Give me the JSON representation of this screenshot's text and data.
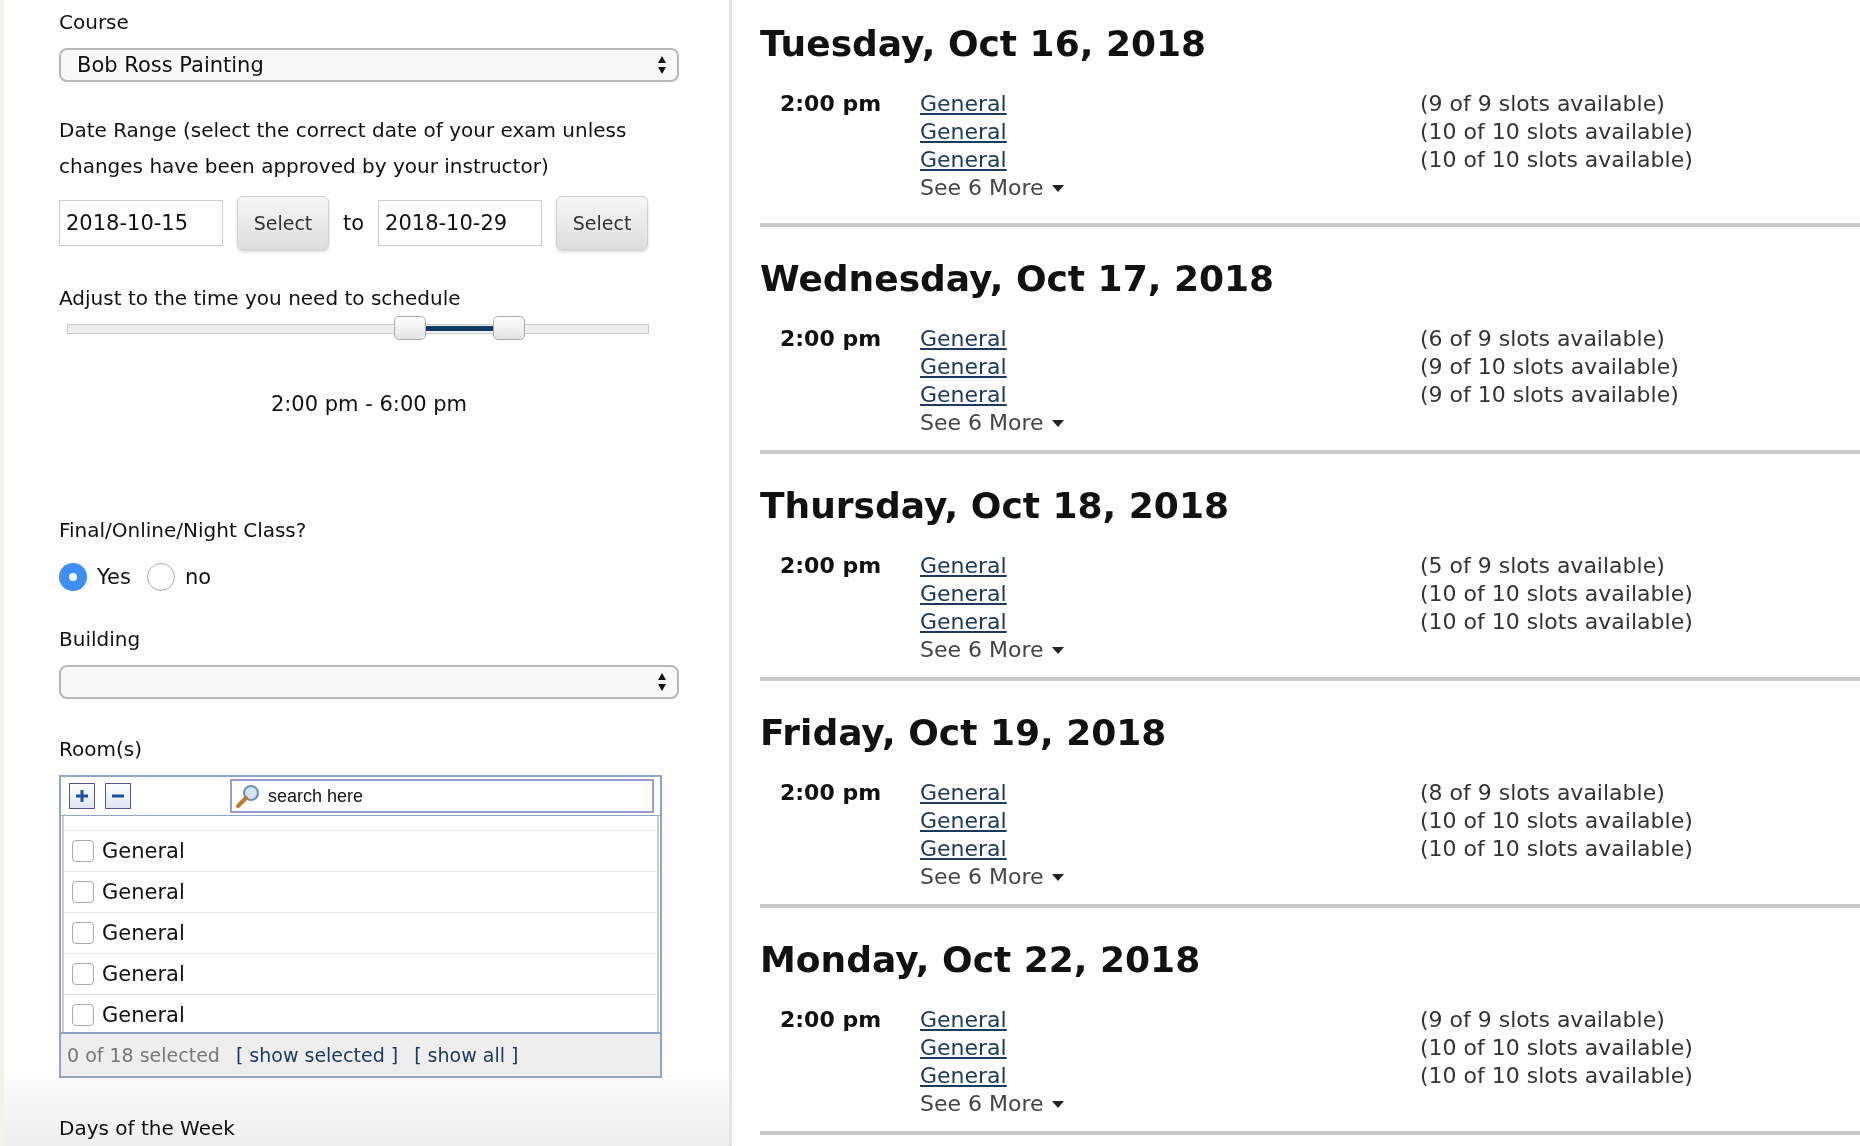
{
  "filters": {
    "course": {
      "label": "Course",
      "value": "Bob Ross Painting"
    },
    "date_range": {
      "label": "Date Range (select the correct date of your exam unless changes have been approved by your instructor)",
      "from": "2018-10-15",
      "from_button": "Select",
      "separator": "to",
      "to": "2018-10-29",
      "to_button": "Select"
    },
    "time_slider": {
      "label": "Adjust to the time you need to schedule",
      "thumbs": [
        {
          "level": 0.59
        },
        {
          "level": 0.76
        }
      ],
      "reading": "2:00 pm - 6:00 pm"
    },
    "final_class": {
      "label": "Final/Online/Night Class?",
      "options": [
        {
          "label": "Yes",
          "selected": true
        },
        {
          "label": "no",
          "selected": false
        }
      ]
    },
    "building": {
      "label": "Building"
    },
    "rooms": {
      "label": "Room(s)",
      "search_placeholder": "search here",
      "items": [
        {
          "label": "General",
          "checked": false
        },
        {
          "label": "General",
          "checked": false
        },
        {
          "label": "General",
          "checked": false
        },
        {
          "label": "General",
          "checked": false
        },
        {
          "label": "General",
          "checked": false
        }
      ],
      "count": "0 of 18 selected",
      "show_selected": "[ show selected ]",
      "show_all": "[ show all ]"
    },
    "days_label": "Days of the Week"
  },
  "days": [
    {
      "title": "Tuesday, Oct 16, 2018",
      "time": "2:00 pm",
      "rooms": [
        {
          "name": "General",
          "slots": "(9 of 9 slots available)"
        },
        {
          "name": "General",
          "slots": "(10 of 10 slots available)"
        },
        {
          "name": "General",
          "slots": "(10 of 10 slots available)"
        }
      ],
      "more": "See 6 More"
    },
    {
      "title": "Wednesday, Oct 17, 2018",
      "time": "2:00 pm",
      "rooms": [
        {
          "name": "General",
          "slots": "(6 of 9 slots available)"
        },
        {
          "name": "General",
          "slots": "(9 of 10 slots available)"
        },
        {
          "name": "General",
          "slots": "(9 of 10 slots available)"
        }
      ],
      "more": "See 6 More"
    },
    {
      "title": "Thursday, Oct 18, 2018",
      "time": "2:00 pm",
      "rooms": [
        {
          "name": "General",
          "slots": "(5 of 9 slots available)"
        },
        {
          "name": "General",
          "slots": "(10 of 10 slots available)"
        },
        {
          "name": "General",
          "slots": "(10 of 10 slots available)"
        }
      ],
      "more": "See 6 More"
    },
    {
      "title": "Friday, Oct 19, 2018",
      "time": "2:00 pm",
      "rooms": [
        {
          "name": "General",
          "slots": "(8 of 9 slots available)"
        },
        {
          "name": "General",
          "slots": "(10 of 10 slots available)"
        },
        {
          "name": "General",
          "slots": "(10 of 10 slots available)"
        }
      ],
      "more": "See 6 More"
    },
    {
      "title": "Monday, Oct 22, 2018",
      "time": "2:00 pm",
      "rooms": [
        {
          "name": "General",
          "slots": "(9 of 9 slots available)"
        },
        {
          "name": "General",
          "slots": "(10 of 10 slots available)"
        },
        {
          "name": "General",
          "slots": "(10 of 10 slots available)"
        }
      ],
      "more": "See 6 More"
    }
  ]
}
